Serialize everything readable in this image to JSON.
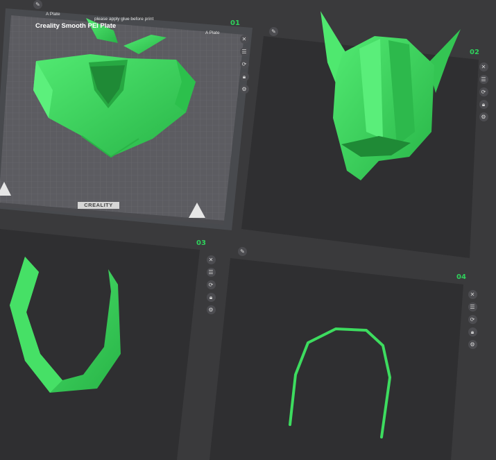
{
  "colors": {
    "background": "#3a3a3c",
    "model_green": "#3ddc5f",
    "plate_number": "#2fd15c",
    "bed_surface": "#5c5c61"
  },
  "plates": [
    {
      "number": "01",
      "bed_title": "Creality Smooth PEI Plate",
      "side_tab_left": "A Plate",
      "side_tab_right": "A Plate",
      "notice": "please apply glue before print",
      "brand": "CREALITY",
      "model": "collar-with-eye-bridge"
    },
    {
      "number": "02",
      "model": "helmet"
    },
    {
      "number": "03",
      "model": "curved-band"
    },
    {
      "number": "04",
      "model": "wire-arch"
    }
  ],
  "toolbar_icons": [
    "close-icon",
    "arrange-icon",
    "auto-orient-icon",
    "lock-icon",
    "settings-icon"
  ],
  "toolbar_glyphs": [
    "✕",
    "☰",
    "⟳",
    "🔒︎",
    "⚙"
  ],
  "edit_glyph": "✎"
}
